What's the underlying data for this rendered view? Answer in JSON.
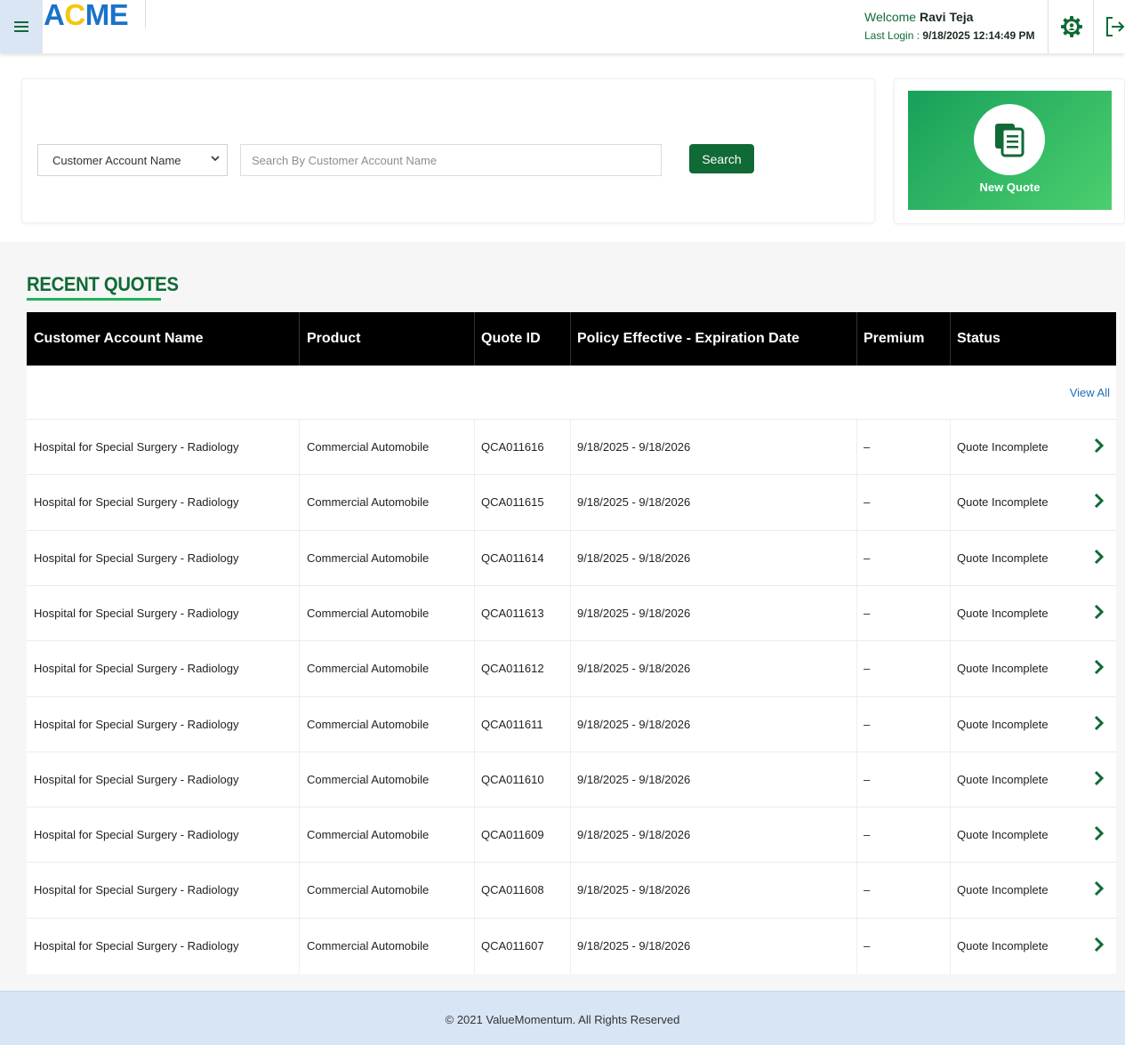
{
  "header": {
    "logo": {
      "part1": "A",
      "part2": "C",
      "part3": "ME"
    },
    "welcome_prefix": "Welcome",
    "user_name": "Ravi Teja",
    "last_login_prefix": "Last Login :",
    "last_login_value": "9/18/2025 12:14:49 PM",
    "icons": [
      "menu-icon",
      "settings-icon",
      "logout-icon"
    ]
  },
  "search": {
    "select_value": "Customer Account Name",
    "placeholder": "Search By Customer Account Name",
    "button_label": "Search"
  },
  "new_quote": {
    "label": "New Quote",
    "icon": "document-icon"
  },
  "recent_quotes": {
    "title": "RECENT QUOTES",
    "view_all": "View All",
    "columns": [
      "Customer Account Name",
      "Product",
      "Quote ID",
      "Policy Effective - Expiration Date",
      "Premium",
      "Status"
    ],
    "rows": [
      {
        "account": "Hospital for Special Surgery - Radiology",
        "product": "Commercial Automobile",
        "quote_id": "QCA011616",
        "dates": "9/18/2025 - 9/18/2026",
        "premium": "–",
        "status": "Quote Incomplete"
      },
      {
        "account": "Hospital for Special Surgery - Radiology",
        "product": "Commercial Automobile",
        "quote_id": "QCA011615",
        "dates": "9/18/2025 - 9/18/2026",
        "premium": "–",
        "status": "Quote Incomplete"
      },
      {
        "account": "Hospital for Special Surgery - Radiology",
        "product": "Commercial Automobile",
        "quote_id": "QCA011614",
        "dates": "9/18/2025 - 9/18/2026",
        "premium": "–",
        "status": "Quote Incomplete"
      },
      {
        "account": "Hospital for Special Surgery - Radiology",
        "product": "Commercial Automobile",
        "quote_id": "QCA011613",
        "dates": "9/18/2025 - 9/18/2026",
        "premium": "–",
        "status": "Quote Incomplete"
      },
      {
        "account": "Hospital for Special Surgery - Radiology",
        "product": "Commercial Automobile",
        "quote_id": "QCA011612",
        "dates": "9/18/2025 - 9/18/2026",
        "premium": "–",
        "status": "Quote Incomplete"
      },
      {
        "account": "Hospital for Special Surgery - Radiology",
        "product": "Commercial Automobile",
        "quote_id": "QCA011611",
        "dates": "9/18/2025 - 9/18/2026",
        "premium": "–",
        "status": "Quote Incomplete"
      },
      {
        "account": "Hospital for Special Surgery - Radiology",
        "product": "Commercial Automobile",
        "quote_id": "QCA011610",
        "dates": "9/18/2025 - 9/18/2026",
        "premium": "–",
        "status": "Quote Incomplete"
      },
      {
        "account": "Hospital for Special Surgery - Radiology",
        "product": "Commercial Automobile",
        "quote_id": "QCA011609",
        "dates": "9/18/2025 - 9/18/2026",
        "premium": "–",
        "status": "Quote Incomplete"
      },
      {
        "account": "Hospital for Special Surgery - Radiology",
        "product": "Commercial Automobile",
        "quote_id": "QCA011608",
        "dates": "9/18/2025 - 9/18/2026",
        "premium": "–",
        "status": "Quote Incomplete"
      },
      {
        "account": "Hospital for Special Surgery - Radiology",
        "product": "Commercial Automobile",
        "quote_id": "QCA011607",
        "dates": "9/18/2025 - 9/18/2026",
        "premium": "–",
        "status": "Quote Incomplete"
      }
    ]
  },
  "footer": {
    "text": "© 2021 ValueMomentum. All Rights Reserved"
  },
  "colors": {
    "brand_green": "#0f6a35",
    "accent_green": "#1fb456",
    "logo_blue": "#1a73c9",
    "logo_yellow": "#f3c60f",
    "link_blue": "#1d6fb8",
    "footer_bg": "#d7e5f5"
  }
}
